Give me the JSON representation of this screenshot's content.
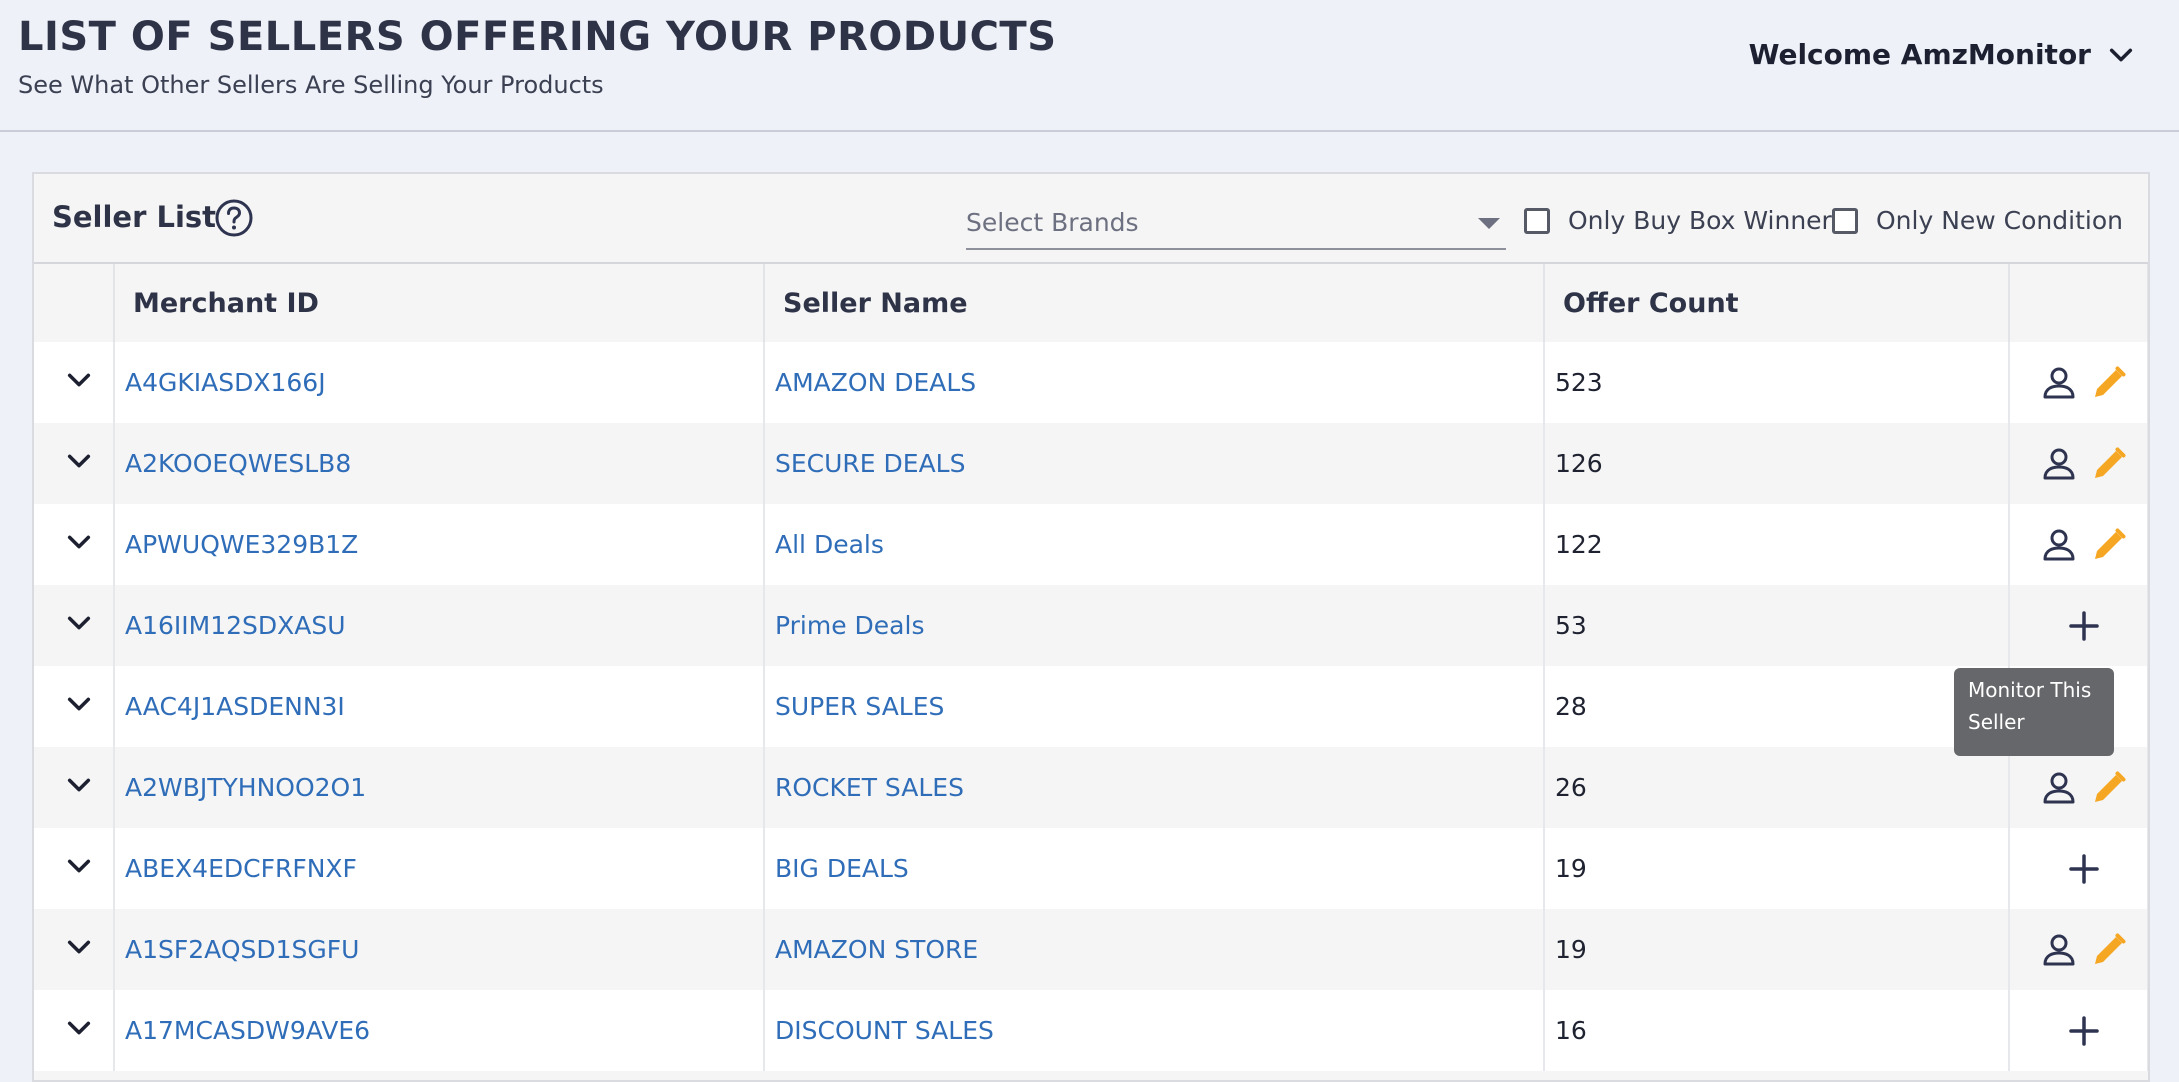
{
  "header": {
    "title": "LIST OF SELLERS OFFERING YOUR PRODUCTS",
    "subtitle": "See What Other Sellers Are Selling Your Products",
    "welcome": "Welcome AmzMonitor"
  },
  "card": {
    "title": "Seller List",
    "brand_placeholder": "Select Brands",
    "filter_buy_box": "Only Buy Box Winner",
    "filter_new_condition": "Only New Condition"
  },
  "table": {
    "columns": [
      "Merchant ID",
      "Seller Name",
      "Offer Count"
    ],
    "rows": [
      {
        "merchant_id": "A4GKIASDX166J",
        "seller_name": "AMAZON DEALS",
        "offer_count": "523",
        "monitored": true
      },
      {
        "merchant_id": "A2KOOEQWESLB8",
        "seller_name": "SECURE DEALS",
        "offer_count": "126",
        "monitored": true
      },
      {
        "merchant_id": "APWUQWE329B1Z",
        "seller_name": "All Deals",
        "offer_count": "122",
        "monitored": true
      },
      {
        "merchant_id": "A16IIM12SDXASU",
        "seller_name": "Prime Deals",
        "offer_count": "53",
        "monitored": false
      },
      {
        "merchant_id": "AAC4J1ASDENN3I",
        "seller_name": "SUPER SALES",
        "offer_count": "28",
        "monitored": false
      },
      {
        "merchant_id": "A2WBJTYHNOO2O1",
        "seller_name": "ROCKET SALES",
        "offer_count": "26",
        "monitored": true
      },
      {
        "merchant_id": "ABEX4EDCFRFNXF",
        "seller_name": "BIG DEALS",
        "offer_count": "19",
        "monitored": false
      },
      {
        "merchant_id": "A1SF2AQSD1SGFU",
        "seller_name": "AMAZON STORE",
        "offer_count": "19",
        "monitored": true
      },
      {
        "merchant_id": "A17MCASDW9AVE6",
        "seller_name": "DISCOUNT SALES",
        "offer_count": "16",
        "monitored": false
      }
    ]
  },
  "tooltip": {
    "text": "Monitor This Seller"
  },
  "colors": {
    "link": "#2f6db8",
    "edit_icon": "#f5a623",
    "icon_dark": "#2e3350"
  }
}
